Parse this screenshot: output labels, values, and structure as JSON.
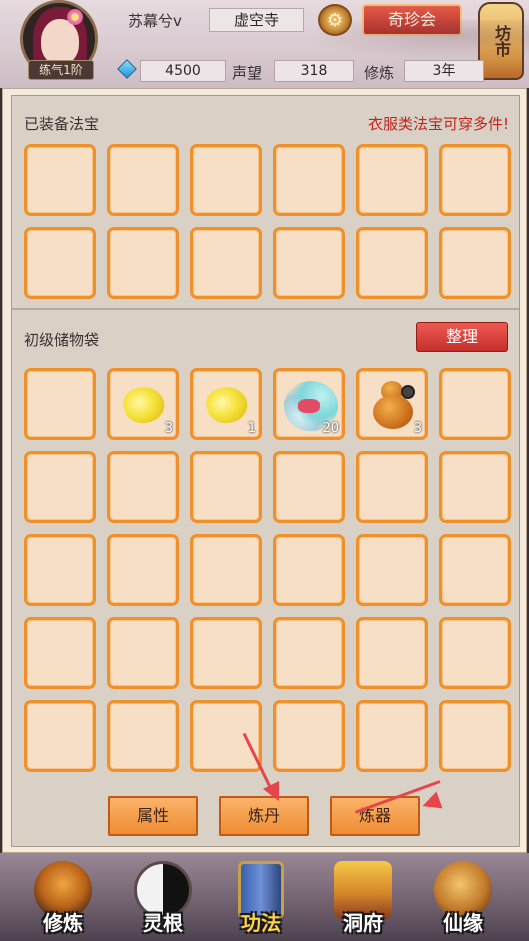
{
  "header": {
    "player_name": "苏幕兮v",
    "sect": "虚空寺",
    "level_badge": "练气1阶",
    "settings_icon": "gear-icon",
    "treasure_button": "奇珍会",
    "market_lantern": "坊市",
    "spirit_stones": "4500",
    "reputation_label": "声望",
    "reputation_value": "318",
    "cultivation_label": "修炼",
    "cultivation_value": "3年"
  },
  "equipped": {
    "title": "已装备法宝",
    "hint": "衣服类法宝可穿多件!"
  },
  "storage": {
    "title": "初级储物袋",
    "sort_button": "整理",
    "items": [
      {
        "slot": 2,
        "icon": "gold-ingot-icon",
        "count": "3"
      },
      {
        "slot": 3,
        "icon": "gold-ingot-icon",
        "count": "1"
      },
      {
        "slot": 4,
        "icon": "feather-fan-icon",
        "count": "20"
      },
      {
        "slot": 5,
        "icon": "gourd-icon",
        "count": "3"
      }
    ]
  },
  "actions": {
    "attributes": "属性",
    "alchemy": "炼丹",
    "refining": "炼器"
  },
  "nav": [
    {
      "label": "修炼",
      "icon": "monk-icon",
      "active": false
    },
    {
      "label": "灵根",
      "icon": "yin-yang-icon",
      "active": false
    },
    {
      "label": "功法",
      "icon": "scroll-book-icon",
      "active": true
    },
    {
      "label": "洞府",
      "icon": "pagoda-icon",
      "active": false
    },
    {
      "label": "仙缘",
      "icon": "immortal-gourd-icon",
      "active": false
    }
  ],
  "colors": {
    "slot_border": "#f0902a",
    "hint_red": "#c2241d",
    "active_nav": "#ffd24a"
  }
}
